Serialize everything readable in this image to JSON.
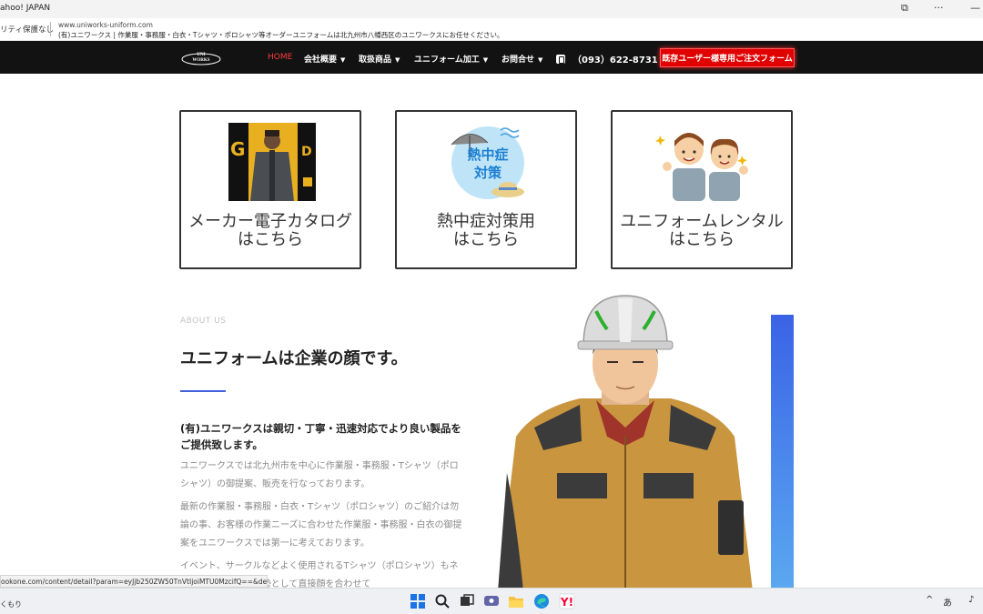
{
  "titlebar": {
    "title": "ahoo! JAPAN"
  },
  "address": {
    "security": "リティ保護なし",
    "url": "www.uniworks-uniform.com",
    "page_title": "(有)ユニワークス | 作業服・事務服・白衣・Tシャツ・ポロシャツ等オーダーユニフォームは北九州市八幡西区のユニワークスにお任せください。"
  },
  "nav": {
    "logo_text": "UNI WORKS",
    "items": [
      {
        "label": "HOME",
        "active": true
      },
      {
        "label": "会社概要",
        "dropdown": true
      },
      {
        "label": "取扱商品",
        "dropdown": true
      },
      {
        "label": "ユニフォーム加工",
        "dropdown": true
      },
      {
        "label": "お問合せ",
        "dropdown": true
      }
    ],
    "phone": "（093）622-8731",
    "order_button": "既存ユーザー様専用ご注文フォーム"
  },
  "cards": [
    {
      "line1": "メーカー電子カタログ",
      "line2": "はこちら"
    },
    {
      "line1": "熱中症対策用",
      "line2": "はこちら",
      "badge_line1": "熱中症",
      "badge_line2": "対策"
    },
    {
      "line1": "ユニフォームレンタル",
      "line2": "はこちら"
    }
  ],
  "about": {
    "label": "ABOUT US",
    "heading": "ユニフォームは企業の顔です。",
    "subheading": "(有)ユニワークスは親切・丁寧・迅速対応でより良い製品をご提供致します。",
    "paragraphs": [
      "ユニワークスでは北九州市を中心に作業服・事務服・Tシャツ（ポロシャツ）の御提案、販売を行なっております。",
      "最新の作業服・事務服・白衣・Tシャツ（ポロシャツ）のご紹介は勿論の事、お客様の作業ニーズに合わせた作業服・事務服・白衣の御提案をユニワークスでは第一に考えております。",
      "イベント、サークルなどよく使用されるTシャツ（ポロシャツ）もネ　　　　ユニワークス基本姿勢として直接顔を合わせて"
    ]
  },
  "status_url": "ookone.com/content/detail?param=eyJjb250ZW50TnVtIjoiMTU0MzcifQ==&detailFlg=0",
  "taskbar": {
    "weather": "くもり",
    "ime": "あ"
  },
  "colors": {
    "nav_bg": "#121212",
    "accent_red": "#e00000",
    "accent_blue": "#3f62d8"
  }
}
